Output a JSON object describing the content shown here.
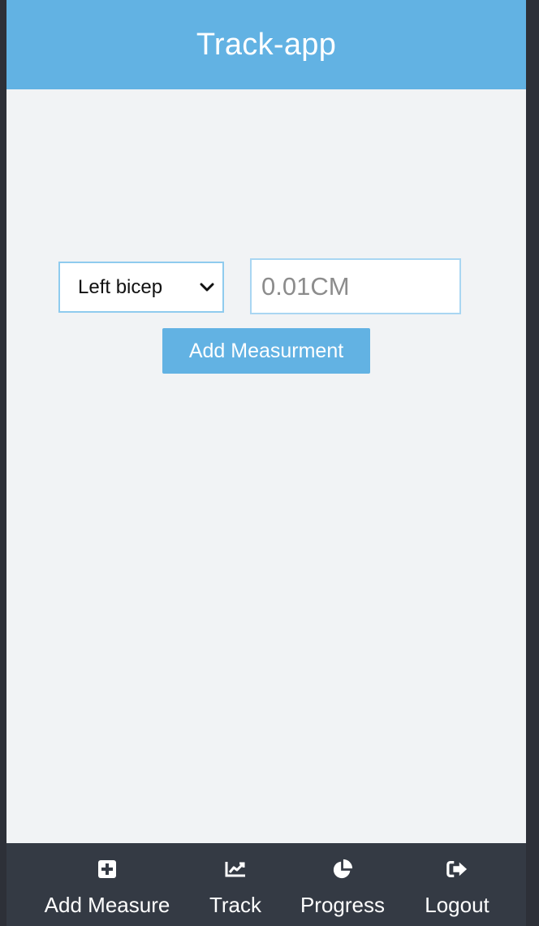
{
  "header": {
    "title": "Track-app"
  },
  "form": {
    "measure_select": {
      "selected": "Left bicep"
    },
    "value_input": {
      "placeholder": "0.01CM",
      "value": ""
    },
    "submit_label": "Add Measurment"
  },
  "bottom_nav": {
    "items": [
      {
        "label": "Add Measure",
        "icon": "plus-square-icon"
      },
      {
        "label": "Track",
        "icon": "chart-line-icon"
      },
      {
        "label": "Progress",
        "icon": "pie-chart-icon"
      },
      {
        "label": "Logout",
        "icon": "logout-icon"
      }
    ]
  },
  "colors": {
    "primary": "#62b2e3",
    "background": "#f1f3f5",
    "nav_background": "#343a44",
    "outer_background": "#2d3038"
  }
}
